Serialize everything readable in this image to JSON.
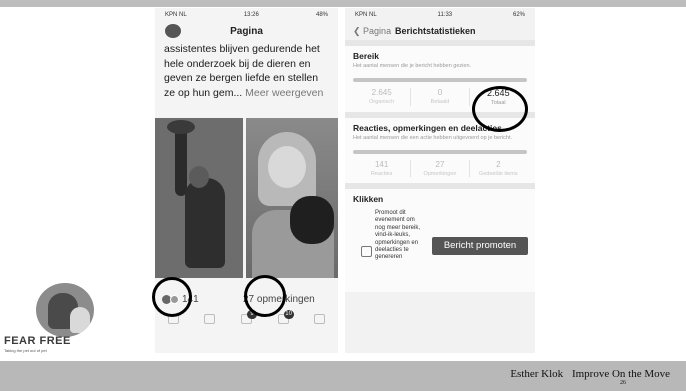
{
  "left_phone": {
    "status": {
      "carrier": "KPN NL",
      "time": "13:26",
      "battery": "48%"
    },
    "title": "Pagina",
    "post_text": "assistentes blijven gedurende het hele onderzoek bij de dieren en geven ze bergen liefde en stellen ze op hun gem...",
    "more_link": "Meer weergeven",
    "reactions_count": "141",
    "comments_label": "27 opmerkingen",
    "tab_badge_1": "9",
    "tab_badge_2": "10"
  },
  "right_phone": {
    "status": {
      "carrier": "KPN NL",
      "time": "11:33",
      "battery": "62%"
    },
    "back_label": "Pagina",
    "title": "Berichtstatistieken",
    "reach": {
      "title": "Bereik",
      "subtitle": "Het aantal mensen die je bericht hebben gezien.",
      "stats": [
        {
          "value": "2.645",
          "label": "Organisch"
        },
        {
          "value": "0",
          "label": "Betaald"
        },
        {
          "value": "2.645",
          "label": "Totaal"
        }
      ]
    },
    "engagement": {
      "title": "Reacties, opmerkingen en deelacties",
      "subtitle": "Het aantal mensen die een actie hebben uitgevoerd op je bericht.",
      "stats": [
        {
          "value": "141",
          "label": "Reacties"
        },
        {
          "value": "27",
          "label": "Opmerkingen"
        },
        {
          "value": "2",
          "label": "Gedeelde items"
        }
      ]
    },
    "clicks": {
      "title": "Klikken",
      "promo_text": "Promoot dit evenement om nog meer bereik, vind-ik-leuks, opmerkingen en deelacties te genereren",
      "promo_button": "Bericht promoten"
    }
  },
  "logo": {
    "title": "FEAR FREE",
    "tagline": "Taking the pet out of pet"
  },
  "footer": {
    "author": "Esther Klok",
    "talk": "Improve On the Move",
    "page": "26"
  }
}
